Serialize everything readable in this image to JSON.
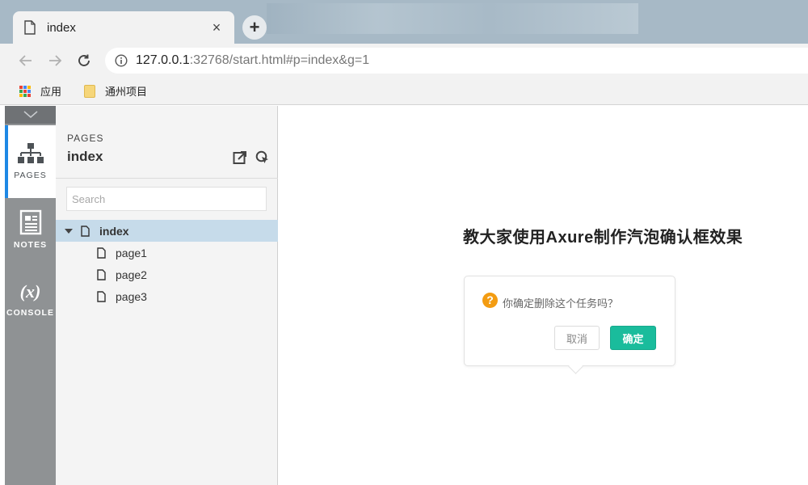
{
  "browser": {
    "tab_title": "index",
    "close_glyph": "×",
    "new_tab_glyph": "+",
    "url_host": "127.0.0.1",
    "url_rest": ":32768/start.html#p=index&g=1"
  },
  "bookmarks": [
    {
      "label": "应用",
      "icon": "apps-grid-icon"
    },
    {
      "label": "通州项目",
      "icon": "folder-icon"
    }
  ],
  "rail": {
    "items": [
      {
        "label": "PAGES",
        "icon": "sitemap-icon",
        "active": true
      },
      {
        "label": "NOTES",
        "icon": "notes-icon",
        "active": false
      },
      {
        "label": "CONSOLE",
        "icon": "variable-icon",
        "active": false
      }
    ],
    "console_glyph": "(x)"
  },
  "pages_panel": {
    "kicker": "PAGES",
    "title": "index",
    "search_placeholder": "Search",
    "tree": [
      {
        "label": "index",
        "level": 0,
        "selected": true
      },
      {
        "label": "page1",
        "level": 1,
        "selected": false
      },
      {
        "label": "page2",
        "level": 1,
        "selected": false
      },
      {
        "label": "page3",
        "level": 1,
        "selected": false
      }
    ]
  },
  "canvas": {
    "heading": "教大家使用Axure制作汽泡确认框效果",
    "bubble_text": "你确定删除这个任务吗？",
    "question_glyph": "?",
    "cancel_label": "取消",
    "ok_label": "确定"
  },
  "colors": {
    "accent": "#1e88e5",
    "confirm": "#1abc9c",
    "question": "#f39c12",
    "rail": "#8f9294",
    "selection": "#c6dbea"
  }
}
